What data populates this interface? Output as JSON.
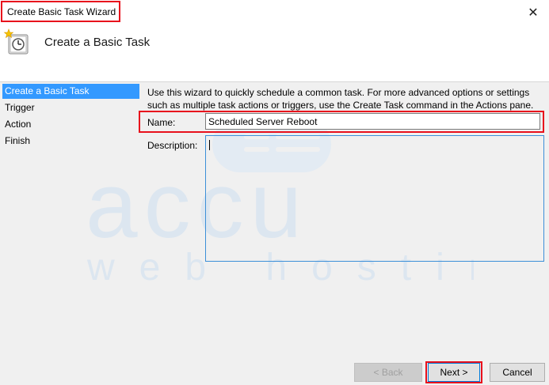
{
  "window": {
    "title": "Create Basic Task Wizard",
    "close_glyph": "✕"
  },
  "header": {
    "title": "Create a Basic Task",
    "icon": "task-scheduler-clock-icon"
  },
  "sidebar": {
    "items": [
      {
        "label": "Create a Basic Task",
        "active": true
      },
      {
        "label": "Trigger",
        "active": false
      },
      {
        "label": "Action",
        "active": false
      },
      {
        "label": "Finish",
        "active": false
      }
    ]
  },
  "main": {
    "description_text": "Use this wizard to quickly schedule a common task.  For more advanced options or settings such as multiple task actions or triggers, use the Create Task command in the Actions pane.",
    "name_label": "Name:",
    "name_value": "Scheduled Server Reboot",
    "description_label": "Description:",
    "description_value": ""
  },
  "watermark": {
    "brand": "accu",
    "tagline": "web hosting"
  },
  "buttons": {
    "back": "< Back",
    "next": "Next >",
    "cancel": "Cancel"
  },
  "colors": {
    "highlight": "#e8101c",
    "selection": "#3399ff",
    "watermark": "#dce6f0"
  }
}
